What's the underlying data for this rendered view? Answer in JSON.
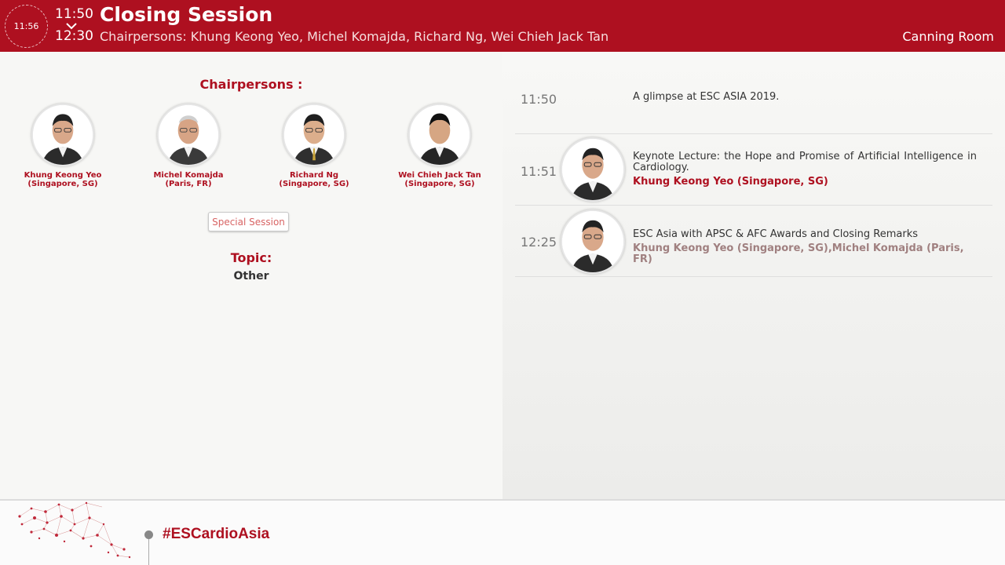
{
  "header": {
    "clock": "11:56",
    "start_time": "11:50",
    "end_time": "12:30",
    "title": "Closing Session",
    "chairpersons_line": "Chairpersons: Khung Keong Yeo, Michel Komajda, Richard Ng, Wei Chieh Jack Tan",
    "room": "Canning Room"
  },
  "left": {
    "chairpersons_title": "Chairpersons :",
    "people": [
      {
        "name": "Khung Keong Yeo",
        "location": "(Singapore, SG)"
      },
      {
        "name": "Michel Komajda",
        "location": "(Paris, FR)"
      },
      {
        "name": "Richard Ng",
        "location": "(Singapore, SG)"
      },
      {
        "name": "Wei Chieh Jack Tan",
        "location": "(Singapore, SG)"
      }
    ],
    "badge": "Special Session",
    "topic_label": "Topic:",
    "topic_value": "Other"
  },
  "agenda": [
    {
      "time": "11:50",
      "title": "A glimpse at ESC ASIA 2019.",
      "speakers": ""
    },
    {
      "time": "11:51",
      "title": "Keynote Lecture: the Hope and Promise of Artificial Intelligence in Cardiology.",
      "speakers": "Khung Keong Yeo (Singapore, SG)"
    },
    {
      "time": "12:25",
      "title": "ESC Asia with APSC & AFC Awards and Closing Remarks",
      "speakers": "Khung Keong Yeo (Singapore, SG),Michel Komajda (Paris, FR)"
    }
  ],
  "footer": {
    "hashtag": "#ESCardioAsia"
  },
  "colors": {
    "brand_red": "#ae1020"
  }
}
